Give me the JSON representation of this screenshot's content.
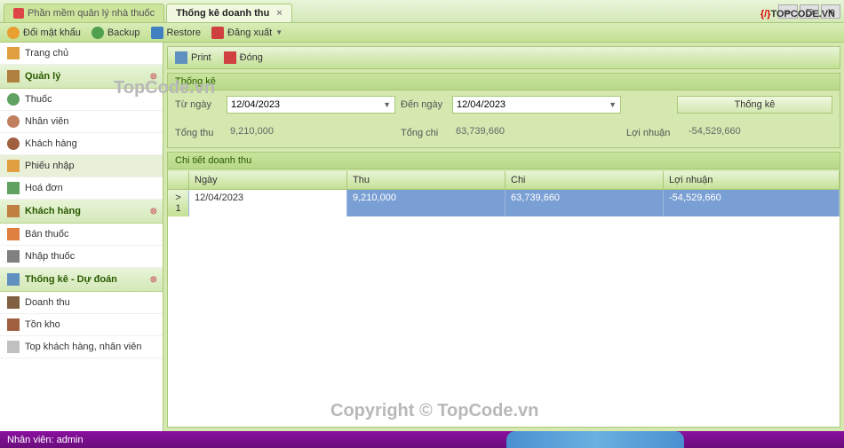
{
  "tabs": {
    "inactive": "Phần mềm quản lý nhà thuốc",
    "active": "Thống kê doanh thu"
  },
  "quickbar": {
    "change_pw": "Đổi mật khẩu",
    "backup": "Backup",
    "restore": "Restore",
    "logout": "Đăng xuất"
  },
  "sidebar": {
    "home": "Trang chủ",
    "manage_header": "Quản lý",
    "thuoc": "Thuốc",
    "nhanvien": "Nhân viên",
    "khachhang": "Khách hàng",
    "phieunhap": "Phiếu nhập",
    "hoadon": "Hoá đơn",
    "kh_header": "Khách hàng",
    "banthuoc": "Bán thuốc",
    "nhapthuoc": "Nhập thuốc",
    "tk_header": "Thống kê - Dự đoán",
    "doanhthu": "Doanh thu",
    "tonkho": "Tồn kho",
    "topkh": "Top khách hàng, nhân viên"
  },
  "toolbar": {
    "print": "Print",
    "close": "Đóng"
  },
  "filter": {
    "group_title": "Thống kê",
    "from_label": "Từ ngày",
    "from_value": "12/04/2023",
    "to_label": "Đến ngày",
    "to_value": "12/04/2023",
    "btn": "Thống kê",
    "tongthu_label": "Tổng thu",
    "tongthu_value": "9,210,000",
    "tongchi_label": "Tổng chi",
    "tongchi_value": "63,739,660",
    "loinhuan_label": "Lợi nhuận",
    "loinhuan_value": "-54,529,660"
  },
  "grid": {
    "title": "Chi tiết doanh thu",
    "col_ngay": "Ngày",
    "col_thu": "Thu",
    "col_chi": "Chi",
    "col_ln": "Lợi nhuận",
    "rows": [
      {
        "idx": "1",
        "ngay": "12/04/2023",
        "thu": "9,210,000",
        "chi": "63,739,660",
        "ln": "-54,529,660"
      }
    ]
  },
  "status": {
    "user_label": "Nhân viên:",
    "user": "admin"
  },
  "watermarks": {
    "w1": "TopCode.vn",
    "w2": "Copyright © TopCode.vn"
  },
  "logo": {
    "left": "{/}",
    "right": "TOPCODE.VN"
  }
}
